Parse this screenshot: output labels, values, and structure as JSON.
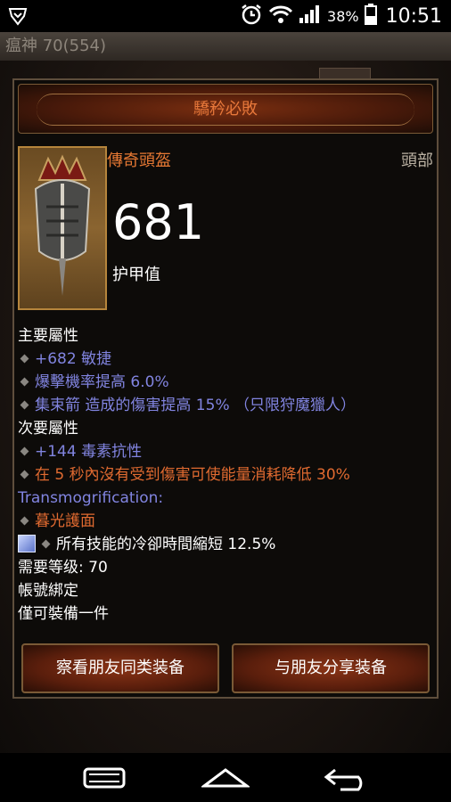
{
  "status_bar": {
    "battery_pct": "38%",
    "time": "10:51"
  },
  "app": {
    "title": "瘟神 70(554)"
  },
  "item": {
    "name": "驕矜必敗",
    "type": "傳奇頭盔",
    "slot": "頭部",
    "armor_value": "681",
    "armor_label": "护甲值",
    "primary_label": "主要屬性",
    "primary_stats": [
      "+682 敏捷",
      "爆擊機率提高 6.0%",
      "集束箭 造成的傷害提高 15% （只限狩魔獵人）"
    ],
    "secondary_label": "次要屬性",
    "secondary_stats": [
      "+144 毒素抗性",
      "在 5 秒內沒有受到傷害可使能量消耗降低 30%"
    ],
    "transmog_label": "Transmogrification:",
    "transmog_value": "暮光護面",
    "socket_effect": "所有技能的冷卻時間縮短 12.5%",
    "required_level": "需要等级: 70",
    "account_bound": "帳號綁定",
    "unique_equipped": "僅可裝備一件"
  },
  "buttons": {
    "compare": "察看朋友同类装备",
    "share": "与朋友分享装备"
  },
  "colors": {
    "legendary": "#e67833",
    "magic": "#8184e0",
    "white": "#ffffff"
  }
}
